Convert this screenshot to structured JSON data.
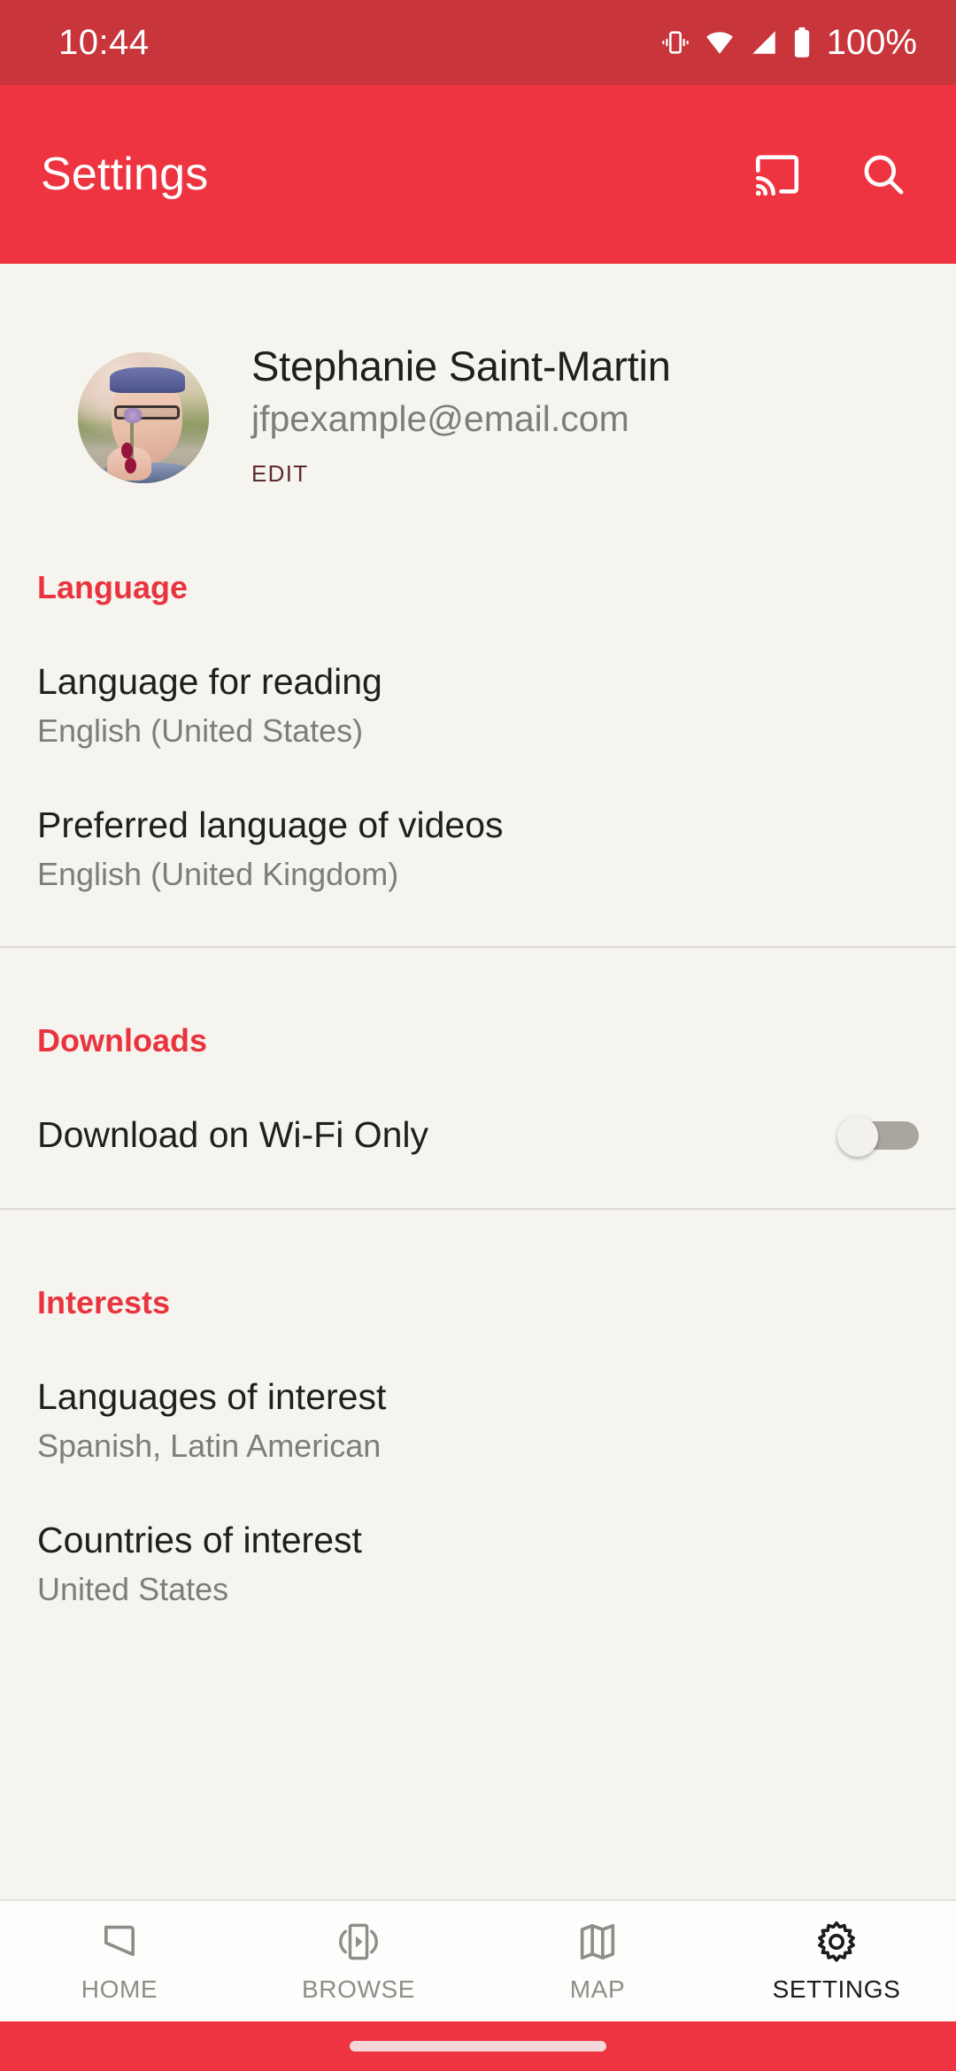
{
  "status_bar": {
    "time": "10:44",
    "battery_text": "100%",
    "icons": [
      "vibrate-icon",
      "wifi-icon",
      "cellular-signal-icon",
      "battery-icon"
    ],
    "background_color": "#c8353b"
  },
  "app_bar": {
    "title": "Settings",
    "background_color": "#ee3440",
    "actions": [
      {
        "name": "cast-icon",
        "label": "Cast"
      },
      {
        "name": "search-icon",
        "label": "Search"
      }
    ]
  },
  "profile": {
    "avatar_alt": "User profile photo",
    "name": "Stephanie Saint-Martin",
    "email": "jfpexample@email.com",
    "edit_label": "EDIT"
  },
  "sections": {
    "language": {
      "header": "Language",
      "items": [
        {
          "title": "Language for reading",
          "subtitle": "English (United States)"
        },
        {
          "title": "Preferred language of videos",
          "subtitle": "English (United Kingdom)"
        }
      ]
    },
    "downloads": {
      "header": "Downloads",
      "toggle_label": "Download on Wi-Fi Only",
      "toggle_state": "off"
    },
    "interests": {
      "header": "Interests",
      "items": [
        {
          "title": "Languages of interest",
          "subtitle": "Spanish, Latin American"
        },
        {
          "title": "Countries of interest",
          "subtitle": "United States"
        }
      ]
    }
  },
  "bottom_nav": {
    "items": [
      {
        "label": "HOME",
        "icon": "home-icon",
        "active": false
      },
      {
        "label": "BROWSE",
        "icon": "browse-video-icon",
        "active": false
      },
      {
        "label": "MAP",
        "icon": "map-icon",
        "active": false
      },
      {
        "label": "SETTINGS",
        "icon": "gear-icon",
        "active": true
      }
    ],
    "accent_color": "#e8343f"
  }
}
